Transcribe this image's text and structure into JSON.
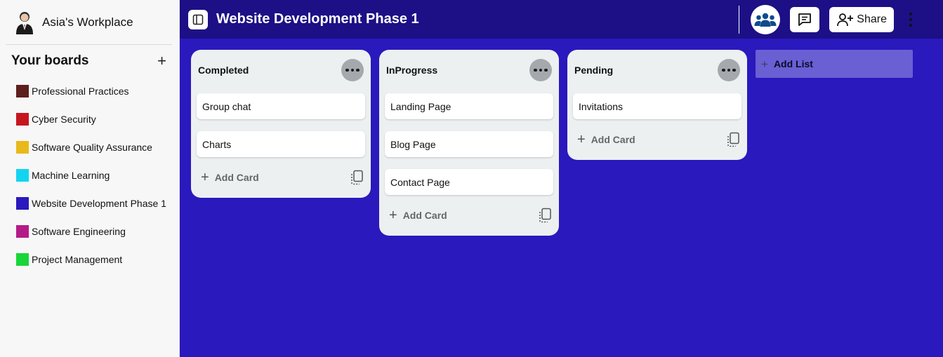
{
  "workspace": {
    "name": "Asia's Workplace"
  },
  "sidebar": {
    "heading": "Your boards",
    "add_symbol": "+",
    "boards": [
      {
        "label": "Professional Practices",
        "color": "#5c1f1c"
      },
      {
        "label": "Cyber Security",
        "color": "#c4161c"
      },
      {
        "label": "Software Quality Assurance",
        "color": "#e9b91a"
      },
      {
        "label": "Machine Learning",
        "color": "#13d4ef"
      },
      {
        "label": "Website Development Phase 1",
        "color": "#2a19bd"
      },
      {
        "label": "Software Engineering",
        "color": "#b51b86"
      },
      {
        "label": "Project Management",
        "color": "#18d63a"
      }
    ]
  },
  "header": {
    "title": "Website Development Phase 1",
    "share_label": "Share"
  },
  "lists": [
    {
      "title": "Completed",
      "cards": [
        "Group chat",
        "Charts"
      ],
      "add_card_label": "Add Card"
    },
    {
      "title": "InProgress",
      "cards": [
        "Landing Page",
        "Blog Page",
        "Contact Page"
      ],
      "add_card_label": "Add Card"
    },
    {
      "title": "Pending",
      "cards": [
        "Invitations"
      ],
      "add_card_label": "Add Card"
    }
  ],
  "add_list_label": "Add List",
  "colors": {
    "background": "#2a19bd",
    "header": "#1d0f86",
    "sidebar": "#f7f7f7"
  }
}
